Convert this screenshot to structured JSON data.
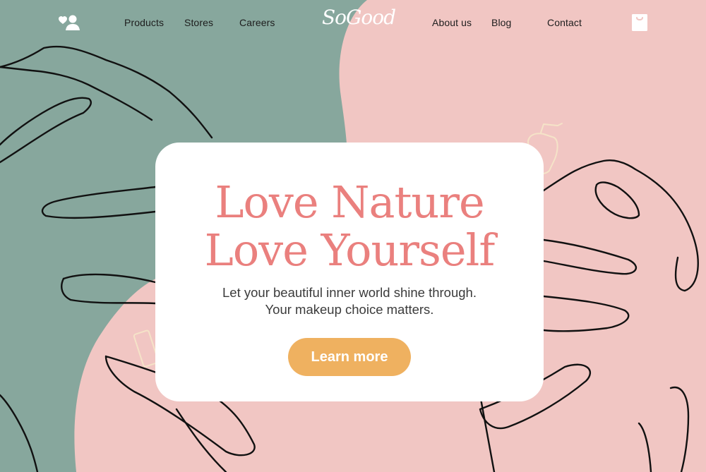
{
  "brand": {
    "logo_text": "SoGood"
  },
  "nav": {
    "left_links": [
      "Products",
      "Stores",
      "Careers"
    ],
    "right_links": [
      "About us",
      "Blog",
      "Contact"
    ]
  },
  "hero": {
    "headline_line1": "Love Nature",
    "headline_line2": "Love Yourself",
    "subtitle_line1": "Let your beautiful inner world shine through.",
    "subtitle_line2": "Your makeup choice matters.",
    "cta_label": "Learn more"
  },
  "icons": {
    "account": "user-heart-icon",
    "cart": "shopping-bag-icon"
  },
  "colors": {
    "sage_green": "#87a79d",
    "blush_pink": "#f1c6c3",
    "headline_coral": "#ea807e",
    "cta_orange": "#efb160",
    "card_white": "#ffffff"
  }
}
